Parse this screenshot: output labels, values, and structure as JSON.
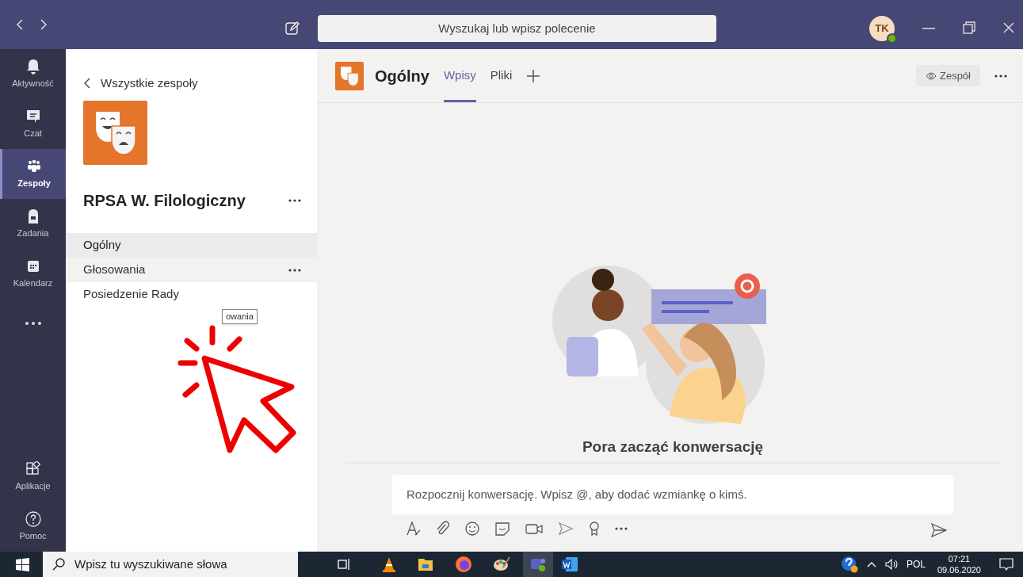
{
  "title_bar": {
    "search_placeholder": "Wyszukaj lub wpisz polecenie",
    "avatar_initials": "TK"
  },
  "app_bar": [
    {
      "label": "Aktywność",
      "selected": false
    },
    {
      "label": "Czat",
      "selected": false
    },
    {
      "label": "Zespoły",
      "selected": true
    },
    {
      "label": "Zadania",
      "selected": false
    },
    {
      "label": "Kalendarz",
      "selected": false
    }
  ],
  "app_bar_bottom": [
    {
      "label": "Aplikacje"
    },
    {
      "label": "Pomoc"
    }
  ],
  "team_panel": {
    "back_link": "Wszystkie zespoły",
    "team_name": "RPSA W. Filologiczny",
    "channels": [
      {
        "name": "Ogólny",
        "selected": true,
        "hovered": false
      },
      {
        "name": "Głosowania",
        "selected": false,
        "hovered": true
      },
      {
        "name": "Posiedzenie Rady",
        "selected": false,
        "hovered": false
      }
    ],
    "tooltip": "owania"
  },
  "channel_header": {
    "title": "Ogólny",
    "tabs": [
      {
        "label": "Wpisy",
        "selected": true
      },
      {
        "label": "Pliki",
        "selected": false
      }
    ],
    "team_button": "Zespół"
  },
  "conversation": {
    "heading": "Pora zacząć konwersację",
    "compose_placeholder": "Rozpocznij konwersację. Wpisz @, aby dodać wzmiankę o kimś."
  },
  "taskbar": {
    "search_placeholder": "Wpisz tu wyszukiwane słowa",
    "language": "POL",
    "time": "07:21",
    "date": "09.06.2020"
  }
}
